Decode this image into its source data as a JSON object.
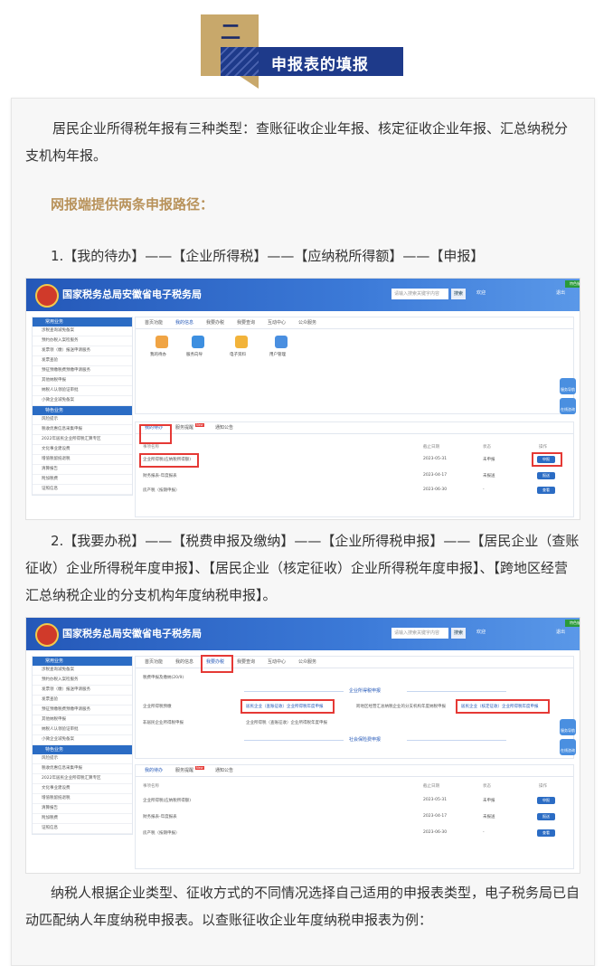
{
  "header": {
    "number": "二",
    "title": "申报表的填报"
  },
  "intro": "居民企业所得税年报有三种类型：查账征收企业年报、核定征收企业年报、汇总纳税分支机构年报。",
  "subheading": "网报端提供两条申报路径：",
  "path1": "1.【我的待办】——【企业所得税】——【应纳税所得额】——【申报】",
  "path2": "2.【我要办税】——【税费申报及缴纳】——【企业所得税申报】——【居民企业（查账征收）企业所得税年度申报】、【居民企业（核定征收）企业所得税年度申报】、【跨地区经营汇总纳税企业的分支机构年度纳税申报】。",
  "outro": "纳税人根据企业类型、征收方式的不同情况选择自己适用的申报表类型，电子税务局已自动匹配纳人年度纳税申报表。以查账征收企业年度纳税申报表为例：",
  "screenshot1": {
    "site_title": "国家税务总局安徽省电子税务局",
    "search_placeholder": "请输入搜索关键字内容",
    "search_button": "搜索",
    "user": "欢迎",
    "exit": "退出",
    "badge": "特色服务",
    "sidebar_head1": "常用业务",
    "sidebar_items1": [
      "涉税查询减免备案",
      "预约办税入案检服务",
      "发票领（缴）报送申请服务",
      "发票查验",
      "预征预缴税费预缴申请服务",
      "其他纳税申报",
      "纳税人认领验证审批",
      "小微企业减免备案"
    ],
    "sidebar_head2": "特色业务",
    "sidebar_items2": [
      "风险提示",
      "税收优惠信息采集申报",
      "2022年居民企业所得税汇算专区",
      "文化事业建设费",
      "增值税留抵退税",
      "清算报告",
      "附加税费",
      "证照信息"
    ],
    "tabs": [
      "首页功能",
      "我的信息",
      "我要办税",
      "我要查询",
      "互动中心",
      "公众服务"
    ],
    "icons": [
      "我的待办",
      "服务向导",
      "电子资料",
      "用户管理"
    ],
    "float1": "服务导航",
    "float2": "在线咨询",
    "lower_tabs": [
      "我的待办",
      "服务提醒",
      "通知公告"
    ],
    "new_badge": "New",
    "cols": [
      "事项名称",
      "截止日期",
      "状态",
      "操作"
    ],
    "rows": [
      {
        "name": "企业所得税(应纳税所得额)",
        "date": "2023-05-31",
        "status": "未申报",
        "op": "申报"
      },
      {
        "name": "财务报表-年度报表",
        "date": "2023-04-17",
        "status": "未报送",
        "op": "报送"
      },
      {
        "name": "房产税（按期申报）",
        "date": "2023-06-30",
        "status": "-",
        "op": "查看"
      }
    ]
  },
  "screenshot2": {
    "site_title": "国家税务总局安徽省电子税务局",
    "search_placeholder": "请输入搜索关键字内容",
    "search_button": "搜索",
    "user": "欢迎",
    "exit": "退出",
    "badge": "特色服务",
    "tabs": [
      "首页功能",
      "我的信息",
      "我要办税",
      "我要查询",
      "互动中心",
      "公众服务"
    ],
    "breadcrumb": "税费申报及缴纳(20/9)",
    "section_title": "企业所得税申报",
    "menu": [
      "企业所得税预缴",
      "居民企业（查账征收）企业所得税年度申报",
      "居民企业（核定征收）企业所得税年度申报",
      "跨地区经营汇总纳税企业的分支机构年度纳税申报",
      "非居民企业所得税申报",
      "企业所得税（查账征收）企业所得税年度申报"
    ],
    "section_title2": "社会保险费申报",
    "float1": "服务导航",
    "float2": "在线咨询",
    "lower_tabs": [
      "我的待办",
      "服务提醒",
      "通知公告"
    ],
    "new_badge": "New",
    "cols": [
      "事项名称",
      "截止日期",
      "状态",
      "操作"
    ],
    "rows": [
      {
        "name": "企业所得税(应纳税所得额)",
        "date": "2023-05-31",
        "status": "未申报",
        "op": "申报"
      },
      {
        "name": "财务报表-年度报表",
        "date": "2023-04-17",
        "status": "未报送",
        "op": "报送"
      },
      {
        "name": "房产税（按期申报）",
        "date": "2023-06-30",
        "status": "-",
        "op": "查看"
      }
    ]
  }
}
